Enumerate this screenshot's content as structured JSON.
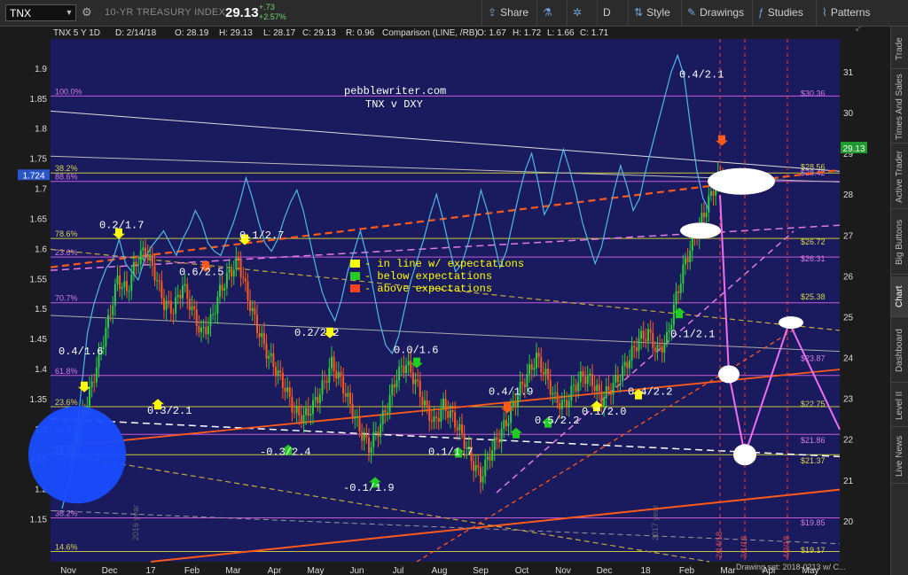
{
  "toolbar": {
    "symbol": "TNX",
    "description": "10-YR TREASURY INDEX",
    "last": "29.13",
    "change": "+.73",
    "change_pct": "+2.57%",
    "share_label": "Share",
    "d_label": "D",
    "style_label": "Style",
    "drawings_label": "Drawings",
    "studies_label": "Studies",
    "patterns_label": "Patterns"
  },
  "sidebar": {
    "tabs": [
      "Trade",
      "Times And Sales",
      "Active Trader",
      "Big Buttons",
      "Chart",
      "Dashboard",
      "Level II",
      "Live News"
    ],
    "active": "Chart"
  },
  "chart_header": {
    "symbol_line": "TNX 5 Y 1D",
    "date": "D: 2/14/18",
    "open": "O: 28.19",
    "high": "H: 29.13",
    "low": "L: 28.17",
    "close": "C: 29.13",
    "ratio": "R: 0.96",
    "comparison": "Comparison (LINE, /RB)",
    "cmp_open": "O: 1.67",
    "cmp_high": "H: 1.72",
    "cmp_low": "L: 1.66",
    "cmp_close": "C: 1.71"
  },
  "footer": {
    "drawing_set": "Drawing set: 2018-0213 w/ C..."
  },
  "annotations": {
    "site": "pebblewriter.com",
    "subtitle": "TNX v DXY",
    "legend": [
      {
        "label": "- in line w/ expectations",
        "color": "#ffff00"
      },
      {
        "label": "- below expectations",
        "color": "#22cc22"
      },
      {
        "label": "- above expectations",
        "color": "#ff4422"
      }
    ],
    "labels": [
      {
        "text": "0.2/1.7",
        "x": 24,
        "y": 1.62
      },
      {
        "text": "0.1/2.7",
        "x": 67,
        "y": 1.605
      },
      {
        "text": "0.6/2.5",
        "x": 45,
        "y": 1.555
      },
      {
        "text": "0.4/1.6",
        "x": 3,
        "y": 1.43
      },
      {
        "text": "0.2/2.2",
        "x": 88,
        "y": 1.455
      },
      {
        "text": "0.0/1.6",
        "x": 122,
        "y": 1.425
      },
      {
        "text": "0.3/2.1",
        "x": 38,
        "y": 1.325
      },
      {
        "text": "-0.3/2.4",
        "x": 72,
        "y": 1.255
      },
      {
        "text": "-0.1/1.9",
        "x": 100,
        "y": 1.2
      },
      {
        "text": "0.1/1.7",
        "x": 130,
        "y": 1.258
      },
      {
        "text": "0.4/1.9",
        "x": 150,
        "y": 1.358
      },
      {
        "text": "0.5/2.2",
        "x": 171,
        "y": 1.31
      },
      {
        "text": "0.1/2.0",
        "x": 185,
        "y": 1.325
      },
      {
        "text": "0.4/2.2",
        "x": 203,
        "y": 1.358
      },
      {
        "text": "0.1/2.1",
        "x": 214,
        "y": 1.458
      },
      {
        "text": "0.4/2.1",
        "x": 224,
        "y": 1.885
      }
    ],
    "fib_left": [
      {
        "label": "100.0%",
        "y": 1.855
      },
      {
        "label": "38.2%",
        "y": 1.727
      },
      {
        "label": "88.6%",
        "y": 1.713
      },
      {
        "label": "78.6%",
        "y": 1.618
      },
      {
        "label": "23.6%",
        "y": 1.587
      },
      {
        "label": "70.7%",
        "y": 1.511
      },
      {
        "label": "61.8%",
        "y": 1.39
      },
      {
        "label": "23.6%",
        "y": 1.338
      },
      {
        "label": "50.0%",
        "y": 1.292
      },
      {
        "label": "14.6%",
        "y": 1.258
      },
      {
        "label": "38.2%",
        "y": 1.153
      },
      {
        "label": "14.6%",
        "y": 1.097
      }
    ],
    "fib_right": [
      {
        "label": "$30.36",
        "y": 30.36
      },
      {
        "label": "$28.56",
        "y": 28.56
      },
      {
        "label": "$28.42",
        "y": 28.42
      },
      {
        "label": "$26.72",
        "y": 26.72
      },
      {
        "label": "$26.31",
        "y": 26.31
      },
      {
        "label": "$25.38",
        "y": 25.38
      },
      {
        "label": "$23.87",
        "y": 23.87
      },
      {
        "label": "$22.75",
        "y": 22.75
      },
      {
        "label": "$21.86",
        "y": 21.86
      },
      {
        "label": "$21.37",
        "y": 21.37
      },
      {
        "label": "$19.85",
        "y": 19.85
      },
      {
        "label": "$19.17",
        "y": 19.17
      }
    ],
    "vertical_dates": [
      "2/14/18",
      "3/1/18",
      "4/3/18"
    ],
    "year_labels": [
      "2016 year",
      "2017 year"
    ]
  },
  "chart_data": {
    "type": "line",
    "left_axis": {
      "ticks": [
        1.15,
        1.2,
        1.25,
        1.3,
        1.35,
        1.4,
        1.45,
        1.5,
        1.55,
        1.6,
        1.65,
        1.7,
        1.75,
        1.8,
        1.85,
        1.9
      ],
      "ylim": [
        1.08,
        1.95
      ],
      "highlight": "1.724"
    },
    "right_axis": {
      "ticks": [
        20,
        21,
        22,
        23,
        24,
        25,
        26,
        27,
        28,
        29,
        30,
        31
      ],
      "ylim": [
        19.0,
        31.8
      ],
      "highlight": "29.13"
    },
    "x_axis": {
      "labels": [
        "Nov",
        "Dec",
        "17",
        "Feb",
        "Mar",
        "Apr",
        "May",
        "Jun",
        "Jul",
        "Aug",
        "Sep",
        "Oct",
        "Nov",
        "Dec",
        "18",
        "Feb",
        "Mar",
        "Apr",
        "May"
      ],
      "xlim": [
        0,
        270
      ]
    },
    "series": [
      {
        "values_tnx": [
          1.62,
          1.74,
          1.8,
          1.78,
          1.86,
          1.87
        ]
      },
      {
        "values_dxy": [
          20.3,
          20.9,
          21.6,
          23.2,
          24.6,
          25.3,
          25.8,
          26.2,
          26.4,
          26.9,
          26.3,
          26.1,
          25.9,
          26.4,
          26.7,
          26.9,
          27.1,
          26.8,
          26.5,
          26.9,
          27.2,
          27.6,
          27.3,
          26.8,
          26.6,
          26.5,
          26.9,
          27.3,
          27.8,
          28.4,
          27.9,
          27.3,
          26.8,
          26.6,
          26.9,
          27.4,
          27.8,
          28.1,
          27.6,
          26.9,
          26.2,
          25.6,
          25.2,
          24.9,
          25.4,
          26.1,
          26.6,
          27.1,
          26.5,
          25.7,
          24.9,
          24.3,
          24.1,
          24.5,
          25.2,
          25.9,
          26.4,
          26.9,
          27.5,
          28.0,
          27.4,
          26.7,
          26.1,
          26.3,
          26.8,
          27.4,
          28.1,
          27.6,
          26.9,
          26.2,
          26.6,
          27.3,
          28.0,
          28.6,
          29.0,
          28.3,
          27.5,
          27.8,
          28.5,
          29.1,
          28.6,
          28.0,
          27.3,
          26.8,
          26.3,
          26.7,
          27.4,
          28.1,
          28.7,
          28.2,
          27.6,
          27.9,
          28.6,
          29.2,
          29.8,
          30.4,
          31.0,
          31.4,
          30.9,
          29.7,
          28.6,
          27.9,
          27.6
        ]
      }
    ],
    "tnx_closes": [
      1.26,
      1.31,
      1.36,
      1.42,
      1.48,
      1.55,
      1.53,
      1.58,
      1.6,
      1.56,
      1.51,
      1.5,
      1.54,
      1.5,
      1.46,
      1.48,
      1.53,
      1.56,
      1.58,
      1.52,
      1.47,
      1.43,
      1.4,
      1.37,
      1.33,
      1.32,
      1.34,
      1.37,
      1.41,
      1.38,
      1.34,
      1.3,
      1.27,
      1.3,
      1.34,
      1.39,
      1.41,
      1.38,
      1.34,
      1.31,
      1.34,
      1.32,
      1.29,
      1.25,
      1.22,
      1.26,
      1.29,
      1.32,
      1.36,
      1.39,
      1.42,
      1.39,
      1.35,
      1.34,
      1.37,
      1.39,
      1.38,
      1.35,
      1.37,
      1.39,
      1.42,
      1.45,
      1.46,
      1.43,
      1.45,
      1.52,
      1.58,
      1.62,
      1.66,
      1.7,
      1.73
    ]
  }
}
